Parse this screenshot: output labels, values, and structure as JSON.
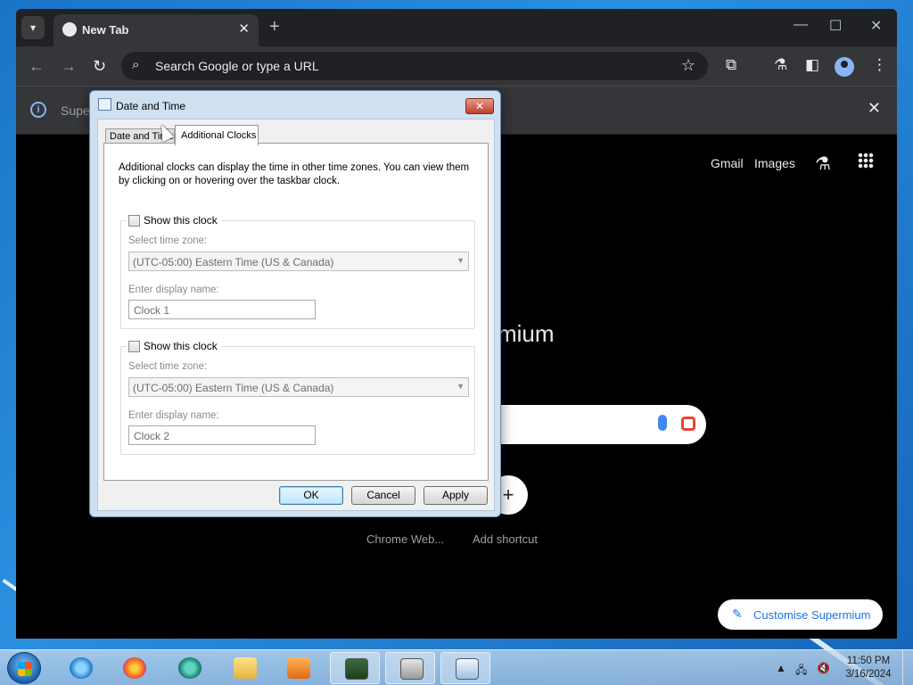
{
  "browser": {
    "tab_title": "New Tab",
    "omnibox_placeholder": "Search Google or type a URL",
    "infobar_text": "Supe",
    "ntp": {
      "gmail": "Gmail",
      "images": "Images",
      "brand_fragment": "mium",
      "shortcut_1": "Chrome Web...",
      "shortcut_2": "Add shortcut",
      "customise": "Customise Supermium"
    }
  },
  "dialog": {
    "title": "Date and Time",
    "tabs": [
      {
        "label": "Date and Time"
      },
      {
        "label": "Additional Clocks"
      }
    ],
    "description": "Additional clocks can display the time in other time zones. You can view them by clicking on or hovering over the taskbar clock.",
    "clocks": [
      {
        "checkbox_label": "Show this clock",
        "checked": false,
        "tz_label": "Select time zone:",
        "tz_value": "(UTC-05:00) Eastern Time (US & Canada)",
        "name_label": "Enter display name:",
        "name_value": "Clock 1"
      },
      {
        "checkbox_label": "Show this clock",
        "checked": false,
        "tz_label": "Select time zone:",
        "tz_value": "(UTC-05:00) Eastern Time (US & Canada)",
        "name_label": "Enter display name:",
        "name_value": "Clock 2"
      }
    ],
    "buttons": {
      "ok": "OK",
      "cancel": "Cancel",
      "apply": "Apply"
    }
  },
  "taskbar": {
    "time": "11:50 PM",
    "date": "3/16/2024",
    "apps": [
      "internet-explorer",
      "firefox",
      "supermium",
      "file-explorer",
      "media-player",
      "system-monitor",
      "disk-utility",
      "date-time-control"
    ]
  },
  "colors": {
    "accent": "#1a73e8",
    "chrome_bg": "#202124",
    "dialog_frame": "#cfe0f1"
  }
}
